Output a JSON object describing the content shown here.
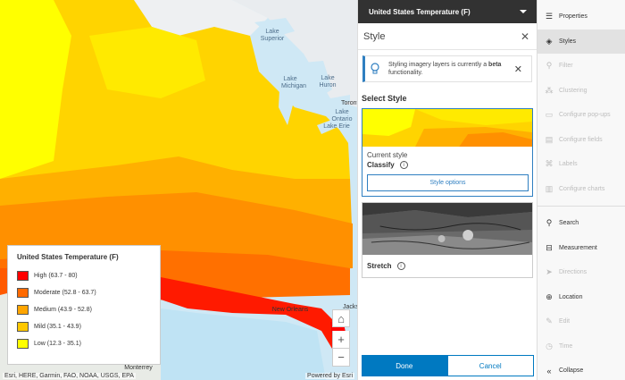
{
  "layer": {
    "title": "United States Temperature (F)"
  },
  "panel": {
    "title": "Style",
    "notice": {
      "text": "Styling imagery layers is currently a",
      "bold": "beta",
      "text_end": "functionality."
    },
    "section": "Select Style",
    "cards": [
      {
        "sub": "Current style",
        "name": "Classify",
        "button": "Style options"
      },
      {
        "name": "Stretch"
      }
    ],
    "done": "Done",
    "cancel": "Cancel"
  },
  "legend": {
    "title": "United States Temperature (F)",
    "items": [
      {
        "label": "High (63.7 - 80)",
        "color": "#ff0000"
      },
      {
        "label": "Moderate (52.8 - 63.7)",
        "color": "#ff6a00"
      },
      {
        "label": "Medium (43.9 - 52.8)",
        "color": "#ffa500"
      },
      {
        "label": "Mild (35.1 - 43.9)",
        "color": "#ffc800"
      },
      {
        "label": "Low (12.3 - 35.1)",
        "color": "#ffff00"
      }
    ]
  },
  "map": {
    "labels": {
      "lake_superior": "Lake Superior",
      "lake_michigan": "Lake Michigan",
      "lake_huron": "Lake Huron",
      "lake_erie": "Lake Erie",
      "lake_ontario": "Lake Ontario",
      "toronto": "Toronto",
      "new_orleans": "New Orleans",
      "monterrey": "Monterrey",
      "jackson": "Jackso"
    },
    "attribution": "Esri, HERE, Garmin, FAO, NOAA, USGS, EPA",
    "powered": "Powered by Esri"
  },
  "toolbar": {
    "items": [
      {
        "label": "Properties",
        "icon": "properties-icon",
        "state": "enabled"
      },
      {
        "label": "Styles",
        "icon": "styles-icon",
        "state": "active"
      },
      {
        "label": "Filter",
        "icon": "filter-icon",
        "state": "disabled"
      },
      {
        "label": "Clustering",
        "icon": "clustering-icon",
        "state": "disabled"
      },
      {
        "label": "Configure pop-ups",
        "icon": "popup-icon",
        "state": "disabled"
      },
      {
        "label": "Configure fields",
        "icon": "fields-icon",
        "state": "disabled"
      },
      {
        "label": "Labels",
        "icon": "labels-icon",
        "state": "disabled"
      },
      {
        "label": "Configure charts",
        "icon": "charts-icon",
        "state": "disabled"
      }
    ],
    "items2": [
      {
        "label": "Search",
        "icon": "search-icon",
        "state": "enabled"
      },
      {
        "label": "Measurement",
        "icon": "measurement-icon",
        "state": "enabled"
      },
      {
        "label": "Directions",
        "icon": "directions-icon",
        "state": "disabled"
      },
      {
        "label": "Location",
        "icon": "location-icon",
        "state": "enabled"
      },
      {
        "label": "Edit",
        "icon": "edit-icon",
        "state": "disabled"
      },
      {
        "label": "Time",
        "icon": "time-icon",
        "state": "disabled"
      },
      {
        "label": "Collapse",
        "icon": "collapse-icon",
        "state": "enabled"
      }
    ]
  }
}
